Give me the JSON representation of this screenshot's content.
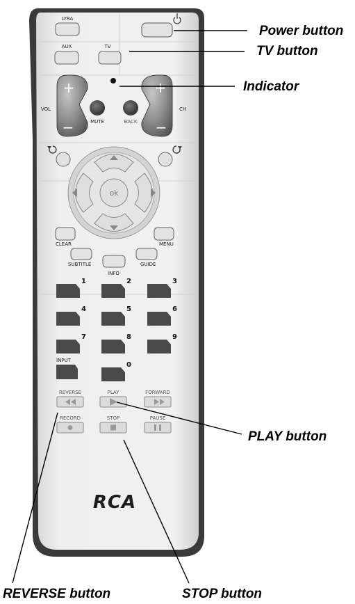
{
  "remote": {
    "brand": "RCA",
    "top_buttons": {
      "lyra": "LYRA",
      "aux": "AUX",
      "tv": "TV"
    },
    "side_labels": {
      "vol": "VOL",
      "ch": "CH",
      "plus": "+",
      "minus": "−"
    },
    "mid_buttons": {
      "mute": "MUTE",
      "back": "BACK",
      "ok": "ok"
    },
    "menu_buttons": {
      "clear": "CLEAR",
      "menu": "MENU",
      "subtitle": "SUBTITLE",
      "guide": "GUIDE",
      "info": "INFO"
    },
    "keypad": [
      "1",
      "2",
      "3",
      "4",
      "5",
      "6",
      "7",
      "8",
      "9",
      "0"
    ],
    "input_label": "INPUT",
    "transport": {
      "reverse": "REVERSE",
      "play": "PLAY",
      "forward": "FORWARD",
      "record": "RECORD",
      "stop": "STOP",
      "pause": "PAUSE"
    }
  },
  "callouts": {
    "power": "Power button",
    "tv": "TV button",
    "indicator": "Indicator",
    "play": "PLAY button",
    "reverse": "REVERSE button",
    "stop": "STOP button"
  }
}
